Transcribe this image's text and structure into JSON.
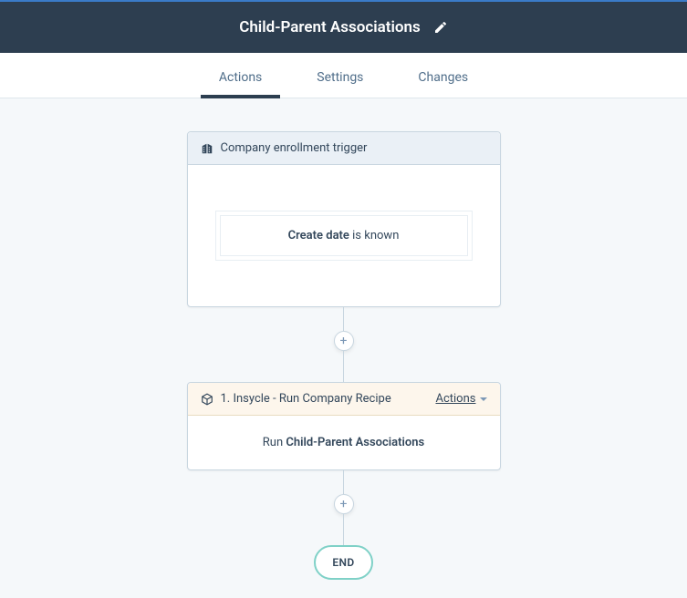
{
  "header": {
    "title": "Child-Parent Associations"
  },
  "tabs": {
    "actions": "Actions",
    "settings": "Settings",
    "changes": "Changes"
  },
  "trigger": {
    "title": "Company enrollment trigger",
    "condition_field": "Create date",
    "condition_text": " is known"
  },
  "plus": "+",
  "step1": {
    "prefix": "1. ",
    "title": "Insycle - Run Company Recipe",
    "actions_label": "Actions",
    "run_label": "Run ",
    "recipe_name": "Child-Parent Associations"
  },
  "end": "END"
}
